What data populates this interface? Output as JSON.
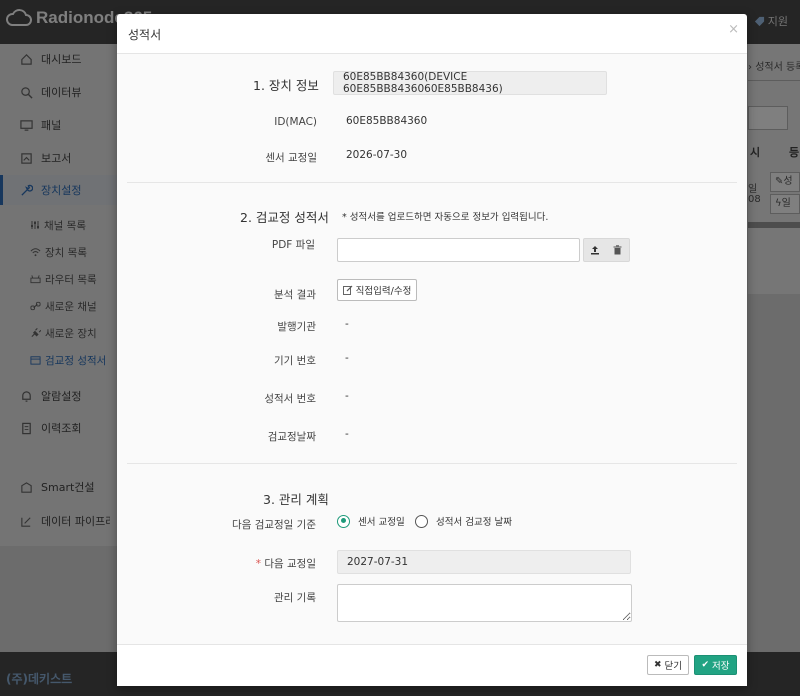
{
  "app": {
    "brand": "Radionode365",
    "support_label": "지원",
    "company": "(주)데키스트"
  },
  "sidebar": {
    "items": [
      {
        "label": "대시보드",
        "icon": "home-icon"
      },
      {
        "label": "데이터뷰",
        "icon": "search-icon"
      },
      {
        "label": "패널",
        "icon": "monitor-icon"
      },
      {
        "label": "보고서",
        "icon": "report-icon"
      },
      {
        "label": "장치설정",
        "icon": "wrench-icon",
        "active": true
      }
    ],
    "sub_items": [
      {
        "label": "채널 목록",
        "icon": "sliders-icon"
      },
      {
        "label": "장치 목록",
        "icon": "wifi-icon"
      },
      {
        "label": "라우터 목록",
        "icon": "router-icon"
      },
      {
        "label": "새로운 채널",
        "icon": "link-icon"
      },
      {
        "label": "새로운 장치",
        "icon": "plug-icon"
      },
      {
        "label": "검교정 성적서",
        "icon": "calendar-icon",
        "active": true
      }
    ],
    "lower_items": [
      {
        "label": "알람설정",
        "icon": "bell-icon"
      },
      {
        "label": "이력조회",
        "icon": "history-icon"
      }
    ],
    "extra_items": [
      {
        "label": "Smart건설",
        "icon": "building-icon"
      },
      {
        "label": "데이터 파이프라인",
        "icon": "pipeline-icon"
      }
    ]
  },
  "background": {
    "breadcrumb": "성적서 등록",
    "table_headers": [
      "시",
      "등"
    ],
    "cell_a": "일",
    "cell_b": "08",
    "button_a": "성",
    "button_b": "일"
  },
  "modal": {
    "title": "성적서",
    "close_label": "×",
    "section1": {
      "title": "1. 장치 정보",
      "device_value": "60E85BB84360(DEVICE 60E85BB8436060E85BB8436)",
      "id_label": "ID(MAC)",
      "id_value": "60E85BB84360",
      "calib_label": "센서 교정일",
      "calib_value": "2026-07-30"
    },
    "section2": {
      "title": "2. 검교정 성적서",
      "note": "* 성적서를 업로드하면 자동으로 정보가 입력됩니다.",
      "pdf_label": "PDF 파일",
      "result_label": "분석 결과",
      "edit_button": "직접입력/수정",
      "issuer_label": "발행기관",
      "issuer_value": "-",
      "equip_label": "기기 번호",
      "equip_value": "-",
      "cert_label": "성적서 번호",
      "cert_value": "-",
      "date_label": "검교정날짜",
      "date_value": "-"
    },
    "section3": {
      "title": "3. 관리 계획",
      "basis_label": "다음 검교정일 기준",
      "option1": "센서 교정일",
      "option2": "성적서 검교정 날짜",
      "selected": "option1",
      "required_mark": "*",
      "next_label": "다음 교정일",
      "next_value": "2027-07-31",
      "memo_label": "관리 기록"
    },
    "footer": {
      "close_button": "닫기",
      "save_button": "저장"
    }
  },
  "colors": {
    "accent": "#21a383",
    "active_nav": "#2f6fba",
    "required": "#d9534f"
  }
}
